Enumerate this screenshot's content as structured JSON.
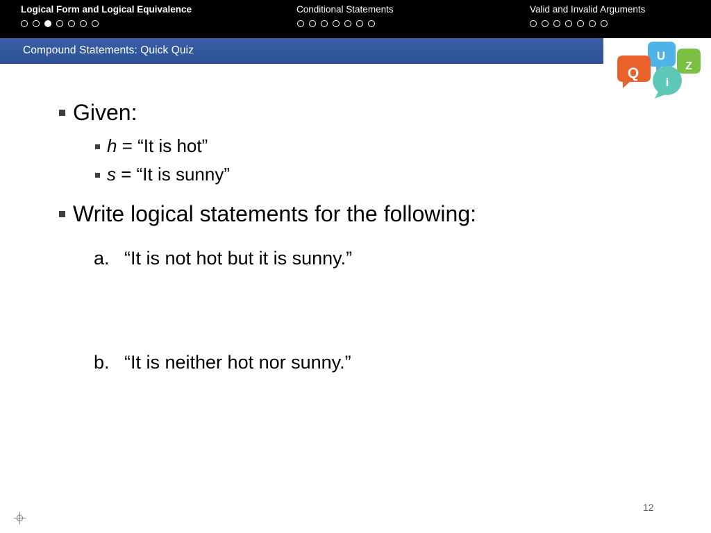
{
  "topbar": {
    "groups": [
      {
        "title": "Logical Form and Logical Equivalence",
        "bold": true,
        "dots": [
          {
            "filled": false
          },
          {
            "filled": false
          },
          {
            "filled": true
          },
          {
            "filled": false
          },
          {
            "filled": false
          },
          {
            "filled": false
          },
          {
            "filled": false
          }
        ]
      },
      {
        "title": "Conditional Statements",
        "bold": false,
        "dots": [
          {
            "filled": false
          },
          {
            "filled": false
          },
          {
            "filled": false
          },
          {
            "filled": false
          },
          {
            "filled": false
          },
          {
            "filled": false
          },
          {
            "filled": false
          }
        ]
      },
      {
        "title": "Valid and Invalid Arguments",
        "bold": false,
        "dots": [
          {
            "filled": false
          },
          {
            "filled": false
          },
          {
            "filled": false
          },
          {
            "filled": false
          },
          {
            "filled": false
          },
          {
            "filled": false
          },
          {
            "filled": false
          }
        ]
      }
    ]
  },
  "subheader": {
    "title": "Compound Statements: Quick Quiz"
  },
  "logo": {
    "letters": [
      "Q",
      "U",
      "Z",
      "i"
    ],
    "colors": {
      "q_orange": "#e8622a",
      "u_blue": "#4fb3e8",
      "z_green": "#7ac143",
      "i_teal": "#5ec8b8"
    }
  },
  "slide": {
    "given_label": "Given:",
    "definitions": [
      {
        "symbol": "h",
        "equals": "= “It is hot”"
      },
      {
        "symbol": "s",
        "equals": "= “It is sunny”"
      }
    ],
    "instruction": "Write logical statements for the following:",
    "questions": [
      {
        "label": "a.",
        "text": "“It is not hot but it is sunny.”"
      },
      {
        "label": "b.",
        "text": "“It is neither hot nor sunny.”"
      }
    ]
  },
  "footer": {
    "page_number": "12"
  }
}
